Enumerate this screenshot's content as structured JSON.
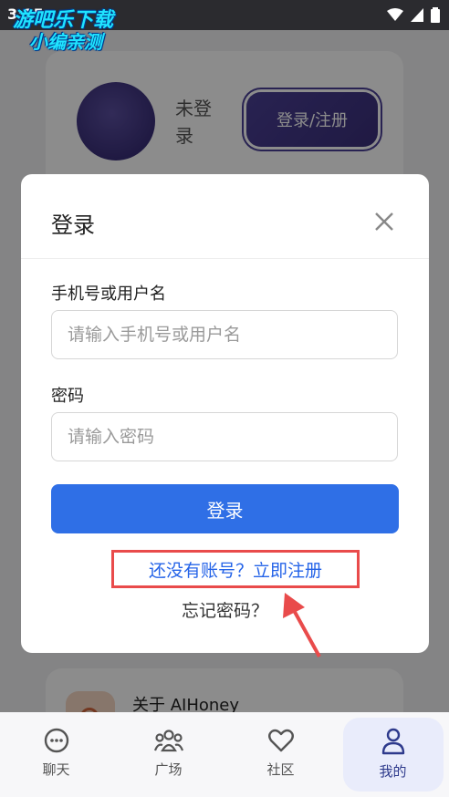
{
  "status_bar": {
    "time": "3:15"
  },
  "watermark": {
    "line1": "游吧乐下载",
    "line2": "小编亲测"
  },
  "profile": {
    "username": "未登录",
    "login_register_label": "登录/注册",
    "avatar_color": "#4a3f95"
  },
  "about": {
    "label": "关于 AIHoney"
  },
  "login_modal": {
    "title": "登录",
    "username_label": "手机号或用户名",
    "username_placeholder": "请输入手机号或用户名",
    "username_value": "",
    "password_label": "密码",
    "password_placeholder": "请输入密码",
    "password_value": "",
    "submit_label": "登录",
    "register_link": "还没有账号？立即注册",
    "forgot_link": "忘记密码？"
  },
  "bottom_nav": {
    "items": [
      {
        "label": "聊天",
        "icon": "chat-icon"
      },
      {
        "label": "广场",
        "icon": "people-icon"
      },
      {
        "label": "社区",
        "icon": "heart-icon"
      },
      {
        "label": "我的",
        "icon": "person-icon",
        "active": true
      }
    ]
  },
  "colors": {
    "primary": "#2f6fe6",
    "highlight_box": "#e94b4b",
    "link": "#2463e8",
    "nav_active_bg": "#e9ecfb"
  }
}
